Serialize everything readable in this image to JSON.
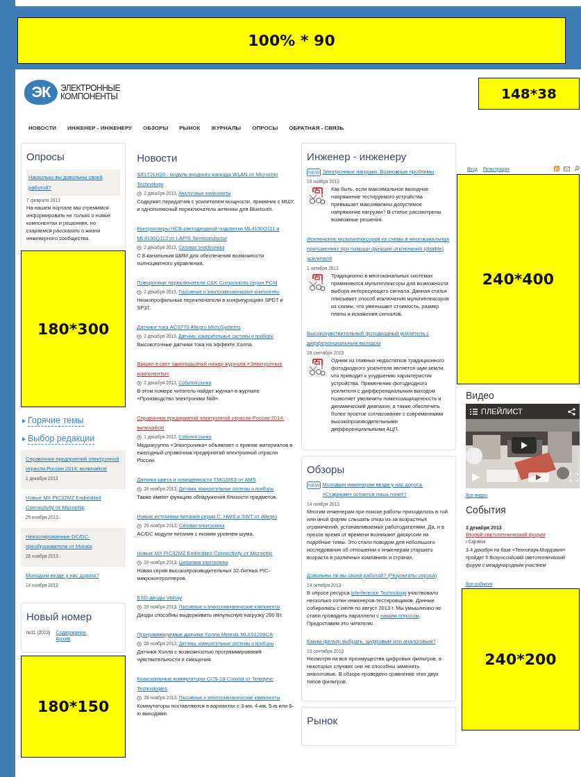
{
  "top_banner": {
    "label": "100% * 90"
  },
  "header": {
    "logo": {
      "mark": "ЭК",
      "line_1": "ЭЛЕКТРОННЫЕ",
      "line_2": "КОМПОНЕНТЫ"
    },
    "ad": {
      "label": "148*38"
    }
  },
  "nav": [
    {
      "label": "НОВОСТИ"
    },
    {
      "label": "ИНЖЕНЕР - ИНЖЕНЕРУ"
    },
    {
      "label": "ОБЗОРЫ"
    },
    {
      "label": "РЫНОК"
    },
    {
      "label": "ЖУРНАЛЫ"
    },
    {
      "label": "ОПРОСЫ"
    },
    {
      "label": "ОБРАТНАЯ - СВЯЗЬ"
    }
  ],
  "left": {
    "poll": {
      "title": "Опросы",
      "question": "Насколько вы довольны своей работой?",
      "date": "7 февраля 2013",
      "text": "На нашем портале мы стремимся информировать не только о новых компонентах и решениях, но стараемся рассказать о жизни инженерного сообщества."
    },
    "ad_1": {
      "label": "180*300"
    },
    "topics": [
      {
        "label": "Горячие темы"
      },
      {
        "label": "Выбор редакции"
      }
    ],
    "editor_picks": [
      {
        "title": "Справочник предприятий электронной отрасли России 2014: включайся!",
        "date": "1 декабря 2013"
      },
      {
        "title": "Новые MX PIC32MZ Embedded Connectivity от Microchip",
        "date": "29 ноября 2013"
      },
      {
        "title": "Неизолированные DC/DC-преобразователи от Murata",
        "date": "26 ноября 2013"
      },
      {
        "title": "Молодым везде у нас дорога?",
        "date": "14 ноября 2013"
      }
    ],
    "new_issue": {
      "title": "Новый номер",
      "number": "№11 (2013)",
      "links": [
        "Содержание",
        "Архив"
      ]
    },
    "ad_2": {
      "label": "180*150"
    }
  },
  "news": {
    "title": "Новости",
    "items": [
      {
        "title": "SX1T2LH20 - модуль входного каскада WLAN от Microchip Technology",
        "color": "#1e6fae",
        "date": "2 декабря 2013,",
        "category": "Аналоговые компоненты",
        "text": "Содержит передатчик с усилителем мощности, приемник с МШУ, и однополюсный переключатель антенны для Bluetooth."
      },
      {
        "title": "Контроллеры HCB-светодиодной подсветки ML4190Q111 и ML4190Q112 от LAPIS Semiconductor",
        "color": "#1e6fae",
        "date": "2 декабря 2013,",
        "category": "Силовая электроника",
        "text": "С 8-канальным ШИМ для обеспечения возможности полноцветного управления."
      },
      {
        "title": "Поворотные переключатели C&K Components серии PCM",
        "color": "#1e6fae",
        "date": "2 декабря 2013,",
        "category": "Пассивные и электромеханические компоненты",
        "text": "Низкопрофильные переключатели в конфигурациях SPDT и SP3T."
      },
      {
        "title": "Датчики тока ACS770 Allegro MicroSystems",
        "color": "#1e6fae",
        "date": "2 декабря 2013,",
        "category": "Датчики, измерительные системы и приборы",
        "text": "Высокоточные датчики тока на эффекте Холла."
      },
      {
        "title": "Вышел в свет одиннадцатый номер журнала «Электронные компоненты»",
        "color": "#b3302b",
        "date": "2 декабря 2013,",
        "category": "События рынка",
        "text": "В этом номере читатель найдет журнал в журнале «Производство электроники №8»."
      },
      {
        "title": "Справочник предприятий электронной отрасли России 2014: включайся!",
        "color": "#b3302b",
        "date": "1 декабря 2013,",
        "category": "События рынка",
        "text": "Медиагруппа «Электроника» объявляет о приеме материалов в ежегодный справочник предприятий электронной отрасли России."
      },
      {
        "title": "Датчики цвета и освещенности TMG3993 от AMS",
        "color": "#1e6fae",
        "date": "29 ноября 2013,",
        "category": "Датчики, измерительные системы и приборы",
        "text": "Также имеют функцию обнаружения близости предметов."
      },
      {
        "title": "Новые источники питания серии C, HWS и SWT от Allegro",
        "color": "#1e6fae",
        "date": "29 ноября 2013,",
        "category": "Силовая электроника",
        "text": "AC/DC модули питания с низким уровнем шума."
      },
      {
        "title": "Новые MX PIC32MZ Embedded Connectivity от Microchip",
        "color": "#1e6fae",
        "date": "29 ноября 2013,",
        "category": "Цифровая электроника",
        "text": "Новая серия высокопроизводительных 32-битных PIC-микроконтроллеров."
      },
      {
        "title": "ESD-диоды Vishay",
        "color": "#1e6fae",
        "date": "29 ноября 2013,",
        "category": "Пассивные и электромеханические компоненты",
        "text": "Диоды способны выдерживать импульсную нагрузку 200 Вт."
      },
      {
        "title": "Программируемые датчики Холла Melexis MLX91209CA",
        "color": "#1e6fae",
        "date": "28 ноября 2013,",
        "category": "Датчики, измерительные системы и приборы",
        "text": "Датчики Холла с возможностью программирования чувствительности и смещения."
      },
      {
        "title": "Коаксиальные коммутаторы CCS-18 Coaxial от Teledyne Technologies",
        "color": "#1e6fae",
        "date": "28 ноября 2013,",
        "category": "Пассивные и электромеханические компоненты",
        "text": "Коммутаторы поставляются в вариантах с 3-мя, 4-мя, 5-ю или 6-ю выходами."
      }
    ]
  },
  "engineer": {
    "title": "Инженер - инженеру",
    "items": [
      {
        "badge": "NEW",
        "title": "Электронные нагрузки. Возможные проблемы",
        "date": "19 ноября 2013",
        "text": "Как быть, если максимальное выходное напряжение тестируемого устройства превышает максимально допустимое напряжение нагрузки? В статье рассмотрены возможные решения."
      },
      {
        "title": "Исключение мультиплексоров из схемы в многоканальных приложениях при помощи функции отключения (disable) усилителя",
        "date": "1 октября 2013",
        "text": "Традиционно в многоканальных системах применяются мультиплексоры для возможности выбора интересующего сигнала. Данная статья описывает способ исключения мультиплексоров из схемы, что уменьшает стоимость, размер платы и искажения сигналов."
      },
      {
        "title": "Высокочувствительный фотодиодный усилитель с дифференциальным выходом",
        "date": "19 сентября 2013",
        "text": "Одним из главных недостатков традиционного фотодиодного усилителя является шум земли, что приводит к ухудшению характеристик устройства. Применение фотодиодного усилителя с дифференциальным выходом позволяет увеличить помехозащищенность и динамический диапазон, а также обеспечить более простое согласование с современными высокопроизводительными дифференциальными АЦП."
      }
    ]
  },
  "reviews": {
    "title": "Обзоры",
    "items": [
      {
        "badge": "NEW",
        "title": "Молодым инженерам везде у нас дорога. «Старикам» остается лишь почет?",
        "date": "14 ноября 2013",
        "text": [
          {
            "kind": "text",
            "text": "Многим инженерам при поиске работы приходилось в той или иной форме слышать отказ из-за возрастных ограничений, устанавливаемых работодателями. Да, и в прессе время от времени возникают дискуссии на подобные темы. Это стало поводом для небольшого исследования об отношении к инженерам старшего возраста в различных компаниях и странах."
          }
        ]
      },
      {
        "title": "Довольны ли вы своей работой? (Результаты опроса)",
        "date": "14 октября 2013",
        "text": [
          {
            "kind": "text",
            "text": "В опросе ресурса "
          },
          {
            "kind": "link",
            "text": "Interference Technology"
          },
          {
            "kind": "text",
            "text": " участвовало несколько сотен инженеров-тестировщиков. Данные собирались с июля по август 2013 г. Мы умышленно не стали проводить параллели с "
          },
          {
            "kind": "link",
            "text": "нашим опросом"
          },
          {
            "kind": "text",
            "text": ". Предоставим это читателю."
          }
        ]
      },
      {
        "title": "Каким фильтр выбрать, цифровым или аналоговым?",
        "date": "13 сентября 2013",
        "text": [
          {
            "kind": "text",
            "text": "Несмотря на все преимущества цифровых фильтров, в некоторых случаях они не способны заменить аналоговые. В обзоре проведено сравнение этих двух типов фильтров."
          }
        ]
      }
    ]
  },
  "market": {
    "title": "Рынок"
  },
  "right": {
    "auth": [
      "Вход",
      "Регистрация"
    ],
    "ad_1": {
      "label": "240*400"
    },
    "video": {
      "title": "Видео",
      "playlist": "ПЛЕЙЛИСТ",
      "all": "Все видео"
    },
    "events": {
      "title": "События",
      "items": [
        {
          "date": "3 декабря 2013",
          "title": "Второй светотехнический форум",
          "place": "г.Саранск",
          "text": "3-4 декабря на базе «Технопарк-Мордовия» пройдет II Всероссийский светотехнический форум с международным участием"
        }
      ],
      "all": "Все события"
    },
    "ad_2": {
      "label": "240*200"
    }
  }
}
